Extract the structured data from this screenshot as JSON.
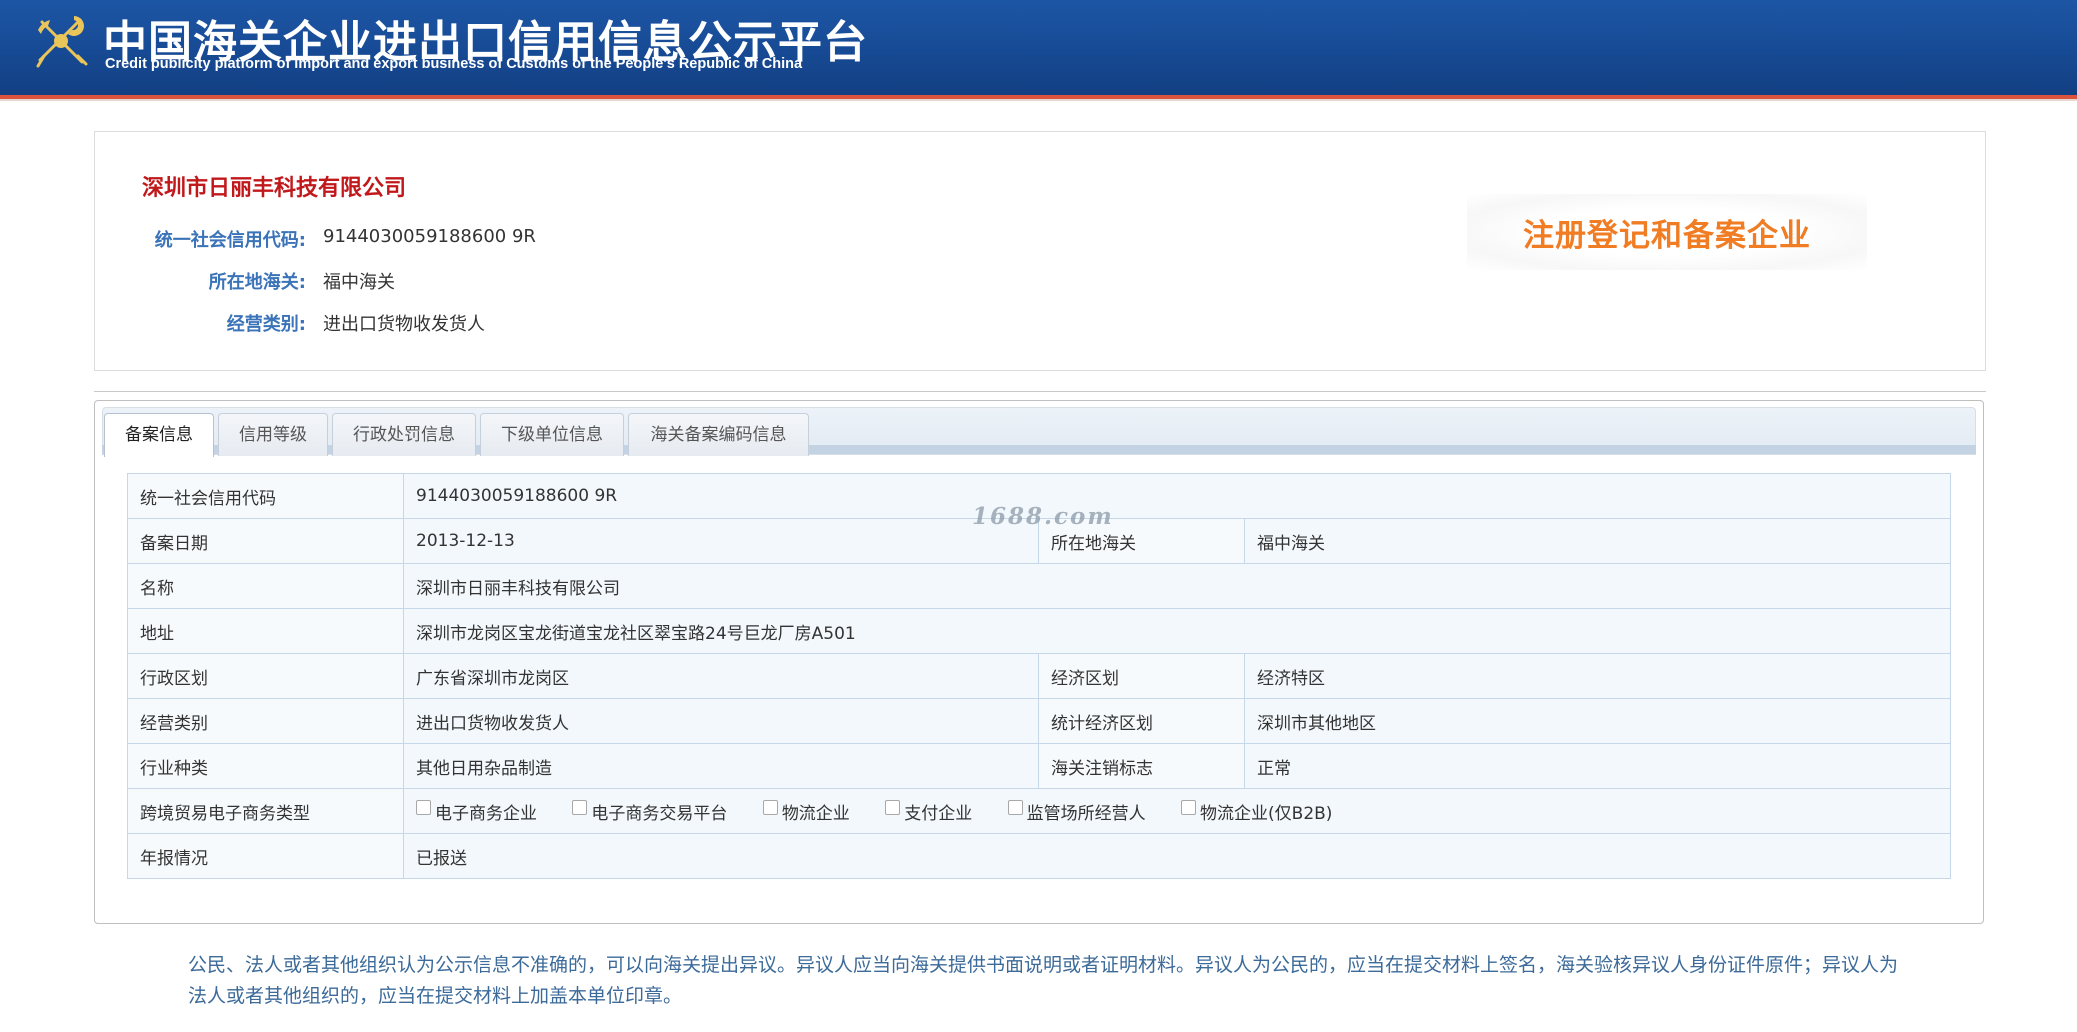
{
  "header": {
    "title": "中国海关企业进出口信用信息公示平台",
    "subtitle": "Credit publicity platform of import and export business of Customs of the People's Republic of China",
    "emblem_icon": "customs-emblem-icon"
  },
  "company": {
    "name": "深圳市日丽丰科技有限公司",
    "credit_code_label": "统一社会信用代码:",
    "credit_code": "9144030059188600 9R",
    "customs_label": "所在地海关:",
    "customs": "福中海关",
    "business_type_label": "经营类别:",
    "business_type": "进出口货物收发货人",
    "badge": "注册登记和备案企业"
  },
  "tabs": [
    {
      "label": "备案信息",
      "active": true
    },
    {
      "label": "信用等级",
      "active": false
    },
    {
      "label": "行政处罚信息",
      "active": false
    },
    {
      "label": "下级单位信息",
      "active": false
    },
    {
      "label": "海关备案编码信息",
      "active": false
    }
  ],
  "record": {
    "credit_code_label": "统一社会信用代码",
    "credit_code": "9144030059188600 9R",
    "filing_date_label": "备案日期",
    "filing_date": "2013-12-13",
    "customs_label": "所在地海关",
    "customs": "福中海关",
    "name_label": "名称",
    "name": "深圳市日丽丰科技有限公司",
    "address_label": "地址",
    "address": "深圳市龙岗区宝龙街道宝龙社区翠宝路24号巨龙厂房A501",
    "admin_region_label": "行政区划",
    "admin_region": "广东省深圳市龙岗区",
    "econ_zone_label": "经济区划",
    "econ_zone": "经济特区",
    "business_type_label": "经营类别",
    "business_type": "进出口货物收发货人",
    "stat_zone_label": "统计经济区划",
    "stat_zone": "深圳市其他地区",
    "industry_label": "行业种类",
    "industry": "其他日用杂品制造",
    "cancel_flag_label": "海关注销标志",
    "cancel_flag": "正常",
    "ecommerce_label": "跨境贸易电子商务类型",
    "ecommerce_options": [
      {
        "label": "电子商务企业",
        "checked": false
      },
      {
        "label": "电子商务交易平台",
        "checked": false
      },
      {
        "label": "物流企业",
        "checked": false
      },
      {
        "label": "支付企业",
        "checked": false
      },
      {
        "label": "监管场所经营人",
        "checked": false
      },
      {
        "label": "物流企业(仅B2B)",
        "checked": false
      }
    ],
    "annual_report_label": "年报情况",
    "annual_report": "已报送"
  },
  "watermark": "1688.com",
  "notice": "公民、法人或者其他组织认为公示信息不准确的，可以向海关提出异议。异议人应当向海关提供书面说明或者证明材料。异议人为公民的，应当在提交材料上签名，海关验核异议人身份证件原件；异议人为法人或者其他组织的，应当在提交材料上加盖本单位印章。",
  "colors": {
    "banner": "#174a94",
    "banner_stripe": "#d9533d",
    "company_name": "#c1181b",
    "label_blue": "#3a73b8",
    "badge_orange": "#f07c24",
    "notice_text": "#3c6a99",
    "table_border": "#c5d7e8"
  }
}
